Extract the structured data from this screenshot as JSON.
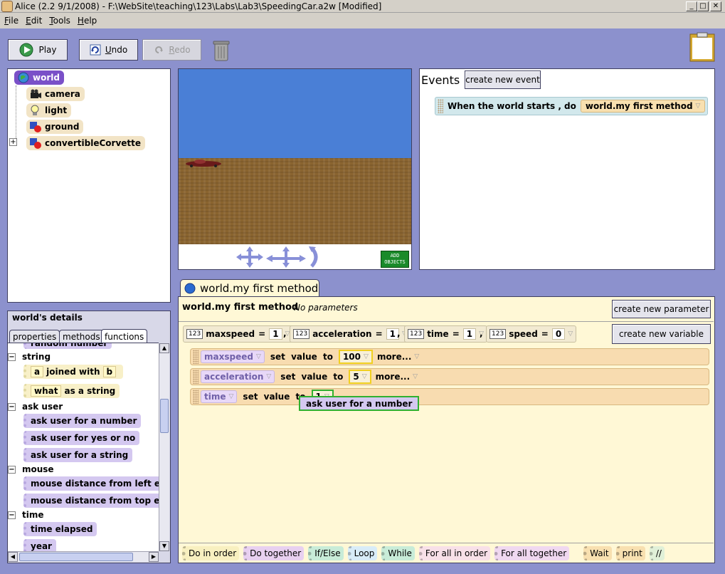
{
  "window": {
    "title": "Alice (2.2  9/1/2008) - F:\\WebSite\\teaching\\123\\Labs\\Lab3\\SpeedingCar.a2w [Modified]",
    "minimize": "_",
    "maximize": "□",
    "close": "✕"
  },
  "menu": {
    "items": [
      {
        "mnemonic": "F",
        "rest": "ile"
      },
      {
        "mnemonic": "E",
        "rest": "dit"
      },
      {
        "mnemonic": "T",
        "rest": "ools"
      },
      {
        "mnemonic": "H",
        "rest": "elp"
      }
    ]
  },
  "toolbar": {
    "play": "Play",
    "undo_mnemonic": "U",
    "undo_rest": "ndo",
    "redo_mnemonic": "R",
    "redo_rest": "edo"
  },
  "object_tree": {
    "expander": "+",
    "items": [
      "world",
      "camera",
      "light",
      "ground",
      "convertibleCorvette"
    ]
  },
  "scene": {
    "add_objects_1": "ADD",
    "add_objects_2": "OBJECTS",
    "sky_color": "#4a7fd6",
    "ground_color": "#8a6430"
  },
  "events": {
    "title": "Events",
    "create_button": "create new event",
    "event_label": "When the world starts ,  do",
    "event_method": "world.my first method"
  },
  "details": {
    "title": "world's details",
    "tabs": [
      "properties",
      "methods",
      "functions"
    ],
    "active_tab": "functions",
    "partial_item": "random number",
    "string_section": "string",
    "string_a": "a",
    "string_joined": "joined with",
    "string_b": "b",
    "what": "what",
    "as_string": "as a string",
    "ask_user_section": "ask user",
    "ask_user_items": [
      "ask user for a number",
      "ask user for yes or no",
      "ask user for a string"
    ],
    "mouse_section": "mouse",
    "mouse_items": [
      "mouse distance from left edge",
      "mouse distance from top edge"
    ],
    "time_section": "time",
    "time_items": [
      "time elapsed",
      "year"
    ]
  },
  "editor": {
    "tab_label": "world.my first method",
    "header_title": "world.my first method",
    "no_params": "No parameters",
    "create_param": "create new parameter",
    "create_var": "create new variable",
    "variables": [
      {
        "badge": "123",
        "name": "maxspeed",
        "eq": "=",
        "value": "1"
      },
      {
        "badge": "123",
        "name": "acceleration",
        "eq": "=",
        "value": "1"
      },
      {
        "badge": "123",
        "name": "time",
        "eq": "=",
        "value": "1"
      },
      {
        "badge": "123",
        "name": "speed",
        "eq": "=",
        "value": "0"
      }
    ],
    "statements": [
      {
        "var": "maxspeed",
        "set": "set value to",
        "value": "100",
        "more": "more..."
      },
      {
        "var": "acceleration",
        "set": "set value to",
        "value": "5",
        "more": "more..."
      },
      {
        "var": "time",
        "set": "set value to",
        "value": "1"
      }
    ],
    "drag_tooltip": "ask user for a number",
    "bottom_tiles": [
      {
        "label": "Do in order",
        "color": "#f8f0c0"
      },
      {
        "label": "Do together",
        "color": "#e8d0f0"
      },
      {
        "label": "If/Else",
        "color": "#c8ecd8"
      },
      {
        "label": "Loop",
        "color": "#d8ecf8"
      },
      {
        "label": "While",
        "color": "#c8ecd8"
      },
      {
        "label": "For all in order",
        "color": "#f8e0e8"
      },
      {
        "label": "For all together",
        "color": "#f0d8f0"
      },
      {
        "label": "Wait",
        "color": "#f8e0b0"
      },
      {
        "label": "print",
        "color": "#f8e0b0"
      },
      {
        "label": "//",
        "color": "#e0f0d8"
      }
    ]
  },
  "colors": {
    "main_bg": "#8c91cd",
    "editor_bg": "#fff8d6",
    "statement": "#f8dcb0",
    "function_tile": "#d4c8f0",
    "selected": "#7a50c8"
  }
}
